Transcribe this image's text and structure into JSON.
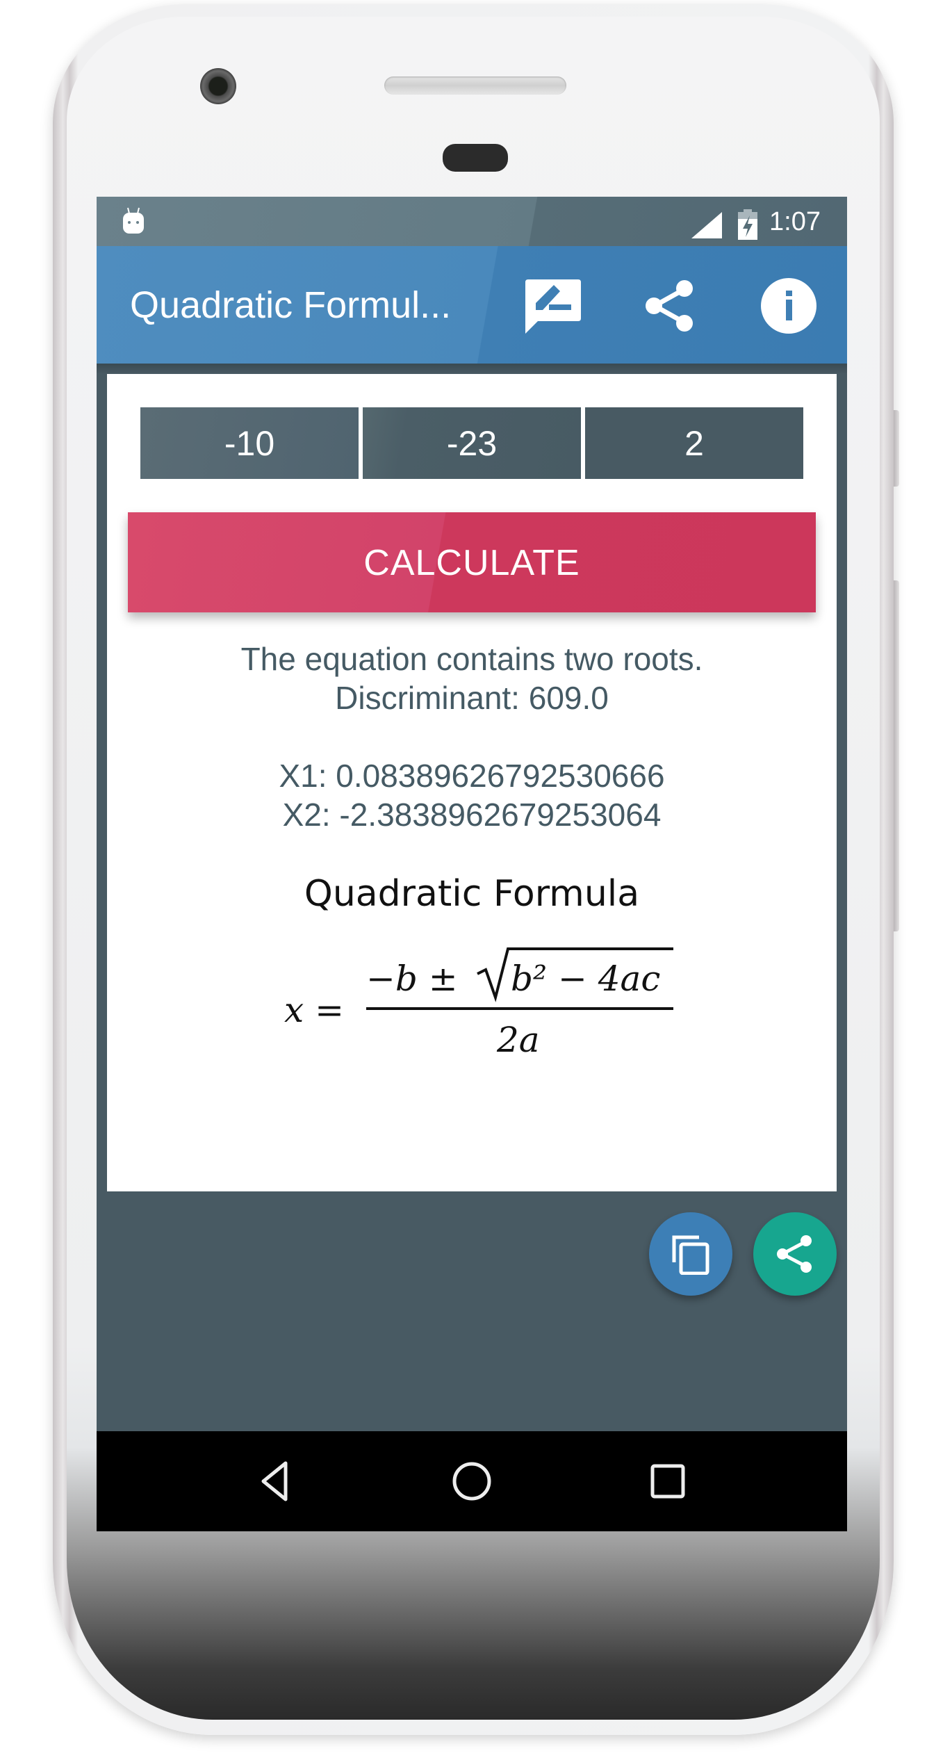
{
  "status_bar": {
    "time": "1:07",
    "icons": [
      "android-notification-icon",
      "signal-icon",
      "battery-charging-icon"
    ]
  },
  "app_bar": {
    "title": "Quadratic Formul...",
    "actions": [
      {
        "name": "feedback",
        "icon": "rate-review-icon"
      },
      {
        "name": "share",
        "icon": "share-icon"
      },
      {
        "name": "info",
        "icon": "info-icon"
      }
    ]
  },
  "inputs": {
    "a": "-10",
    "b": "-23",
    "c": "2"
  },
  "calculate_button": {
    "label": "CALCULATE"
  },
  "result": {
    "summary": "The equation contains two roots.",
    "discriminant": "Discriminant: 609.0",
    "x1": "X1: 0.08389626792530666",
    "x2": "X2: -2.3838962679253064"
  },
  "formula": {
    "title": "Quadratic Formula",
    "lhs": "x =",
    "numerator_neg_b": "−b ±",
    "radicand": "b² − 4ac",
    "denominator": "2a"
  },
  "fabs": [
    {
      "name": "copy",
      "icon": "copy-icon"
    },
    {
      "name": "share",
      "icon": "share-icon"
    }
  ],
  "nav_bar": {
    "buttons": [
      "back",
      "home",
      "recents"
    ]
  },
  "colors": {
    "app_bar": "#3f7fb4",
    "status_bar": "#5a717b",
    "background": "#485a63",
    "input_fill": "#4b5e67",
    "calculate_button": "#cf3b5f",
    "result_text": "#455a64",
    "fab_copy": "#3d7fb6",
    "fab_share": "#17a68f"
  }
}
